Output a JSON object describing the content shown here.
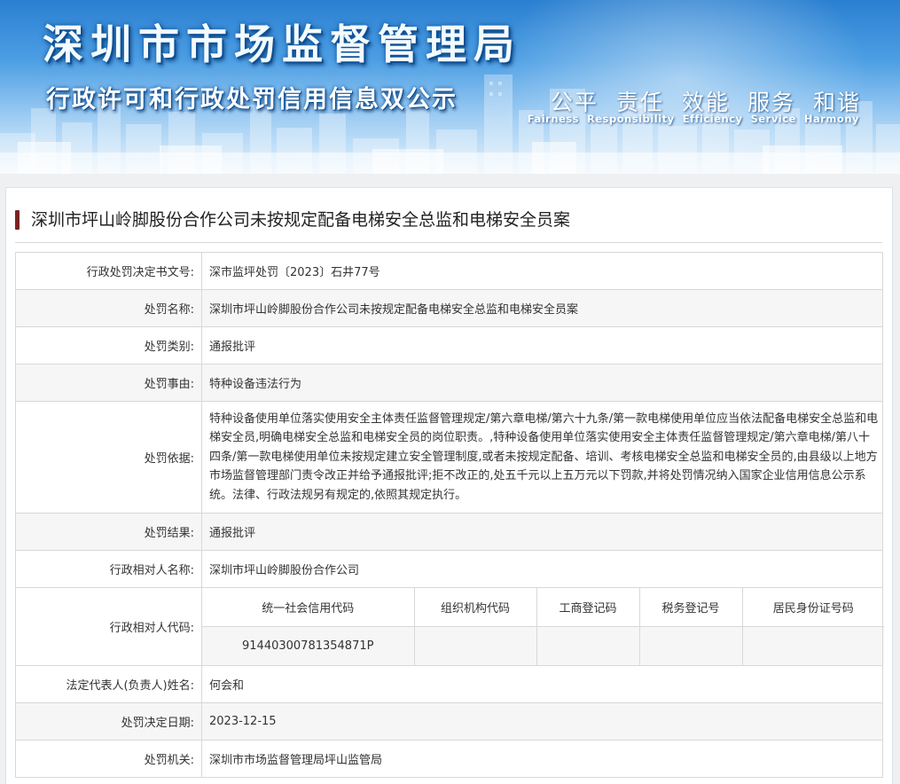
{
  "banner": {
    "title": "深圳市市场监督管理局",
    "subtitle": "行政许可和行政处罚信用信息双公示",
    "slogan_cn": [
      "公平",
      "责任",
      "效能",
      "服务",
      "和谐"
    ],
    "slogan_en": [
      "Fairness",
      "Responsibility",
      "Efficiency",
      "Service",
      "Harmony"
    ]
  },
  "case": {
    "title": "深圳市坪山岭脚股份合作公司未按规定配备电梯安全总监和电梯安全员案"
  },
  "details": {
    "doc_no_label": "行政处罚决定书文号:",
    "doc_no": "深市监坪处罚〔2023〕石井77号",
    "name_label": "处罚名称:",
    "name": "深圳市坪山岭脚股份合作公司未按规定配备电梯安全总监和电梯安全员案",
    "category_label": "处罚类别:",
    "category": "通报批评",
    "reason_label": "处罚事由:",
    "reason": "特种设备违法行为",
    "basis_label": "处罚依据:",
    "basis": "特种设备使用单位落实使用安全主体责任监督管理规定/第六章电梯/第六十九条/第一款电梯使用单位应当依法配备电梯安全总监和电梯安全员,明确电梯安全总监和电梯安全员的岗位职责。,特种设备使用单位落实使用安全主体责任监督管理规定/第六章电梯/第八十四条/第一款电梯使用单位未按规定建立安全管理制度,或者未按规定配备、培训、考核电梯安全总监和电梯安全员的,由县级以上地方市场监督管理部门责令改正并给予通报批评;拒不改正的,处五千元以上五万元以下罚款,并将处罚情况纳入国家企业信用信息公示系统。法律、行政法规另有规定的,依照其规定执行。",
    "result_label": "处罚结果:",
    "result": "通报批评",
    "party_name_label": "行政相对人名称:",
    "party_name": "深圳市坪山岭脚股份合作公司",
    "party_code_label": "行政相对人代码:",
    "code_headers": [
      "统一社会信用代码",
      "组织机构代码",
      "工商登记码",
      "税务登记号",
      "居民身份证号码"
    ],
    "code_values": [
      "91440300781354871P",
      "",
      "",
      "",
      ""
    ],
    "legal_rep_label": "法定代表人(负责人)姓名:",
    "legal_rep": "何会和",
    "date_label": "处罚决定日期:",
    "date": "2023-12-15",
    "authority_label": "处罚机关:",
    "authority": "深圳市市场监督管理局坪山监管局"
  }
}
